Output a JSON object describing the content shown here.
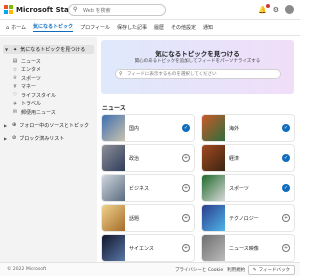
{
  "header": {
    "brand": "Microsoft Start",
    "logo_colors": [
      "#f25022",
      "#7fba00",
      "#00a4ef",
      "#ffb900"
    ],
    "search_placeholder": "Web を検索",
    "icons": [
      "bell-icon",
      "gear-icon",
      "avatar"
    ]
  },
  "nav": {
    "items": [
      {
        "label": "ホーム",
        "icon": "home-icon",
        "active": false
      },
      {
        "label": "気になるトピック",
        "active": true
      },
      {
        "label": "プロフィール",
        "active": false
      },
      {
        "label": "保存した記事",
        "active": false
      },
      {
        "label": "履歴",
        "active": false
      },
      {
        "label": "その他設定",
        "active": false
      },
      {
        "label": "通知",
        "active": false
      }
    ]
  },
  "sidebar": {
    "discover": {
      "label": "気になるトピックを見つける",
      "icon": "sparkle-icon"
    },
    "items": [
      {
        "label": "ニュース",
        "icon": "news-icon"
      },
      {
        "label": "エンタメ",
        "icon": "star-icon"
      },
      {
        "label": "スポーツ",
        "icon": "trophy-icon"
      },
      {
        "label": "マネー",
        "icon": "money-icon"
      },
      {
        "label": "ライフスタイル",
        "icon": "heart-icon"
      },
      {
        "label": "トラベル",
        "icon": "plane-icon"
      },
      {
        "label": "郵便用ニュース",
        "icon": "mail-icon"
      }
    ],
    "following": {
      "label": "フォロー中のソースとトピック",
      "icon": "follow-icon"
    },
    "blocked": {
      "label": "ブロック済みリスト",
      "icon": "block-icon"
    }
  },
  "banner": {
    "title": "気になるトピックを見つける",
    "subtitle": "関心のあるトピックを追加してフィードをパーソナライズする",
    "search_placeholder": "フィードに表示するものを選択してください"
  },
  "section": {
    "title": "ニュース"
  },
  "topics": [
    {
      "label": "国内",
      "followed": true,
      "colors": [
        "#3f6fb1",
        "#c9c3ad"
      ]
    },
    {
      "label": "海外",
      "followed": true,
      "colors": [
        "#c85a2a",
        "#2e6d3b"
      ]
    },
    {
      "label": "政治",
      "followed": false,
      "colors": [
        "#8c8f97",
        "#2f3d5a"
      ]
    },
    {
      "label": "経済",
      "followed": true,
      "colors": [
        "#a2491f",
        "#3b2514"
      ]
    },
    {
      "label": "ビジネス",
      "followed": false,
      "colors": [
        "#cfd6de",
        "#5b6c80"
      ]
    },
    {
      "label": "スポーツ",
      "followed": true,
      "colors": [
        "#1f6a2c",
        "#d9d9d9"
      ]
    },
    {
      "label": "話題",
      "followed": false,
      "colors": [
        "#efd28b",
        "#a56c2a"
      ]
    },
    {
      "label": "テクノロジー",
      "followed": false,
      "colors": [
        "#2a3c8c",
        "#4fb5e8"
      ]
    },
    {
      "label": "サイエンス",
      "followed": false,
      "colors": [
        "#10162b",
        "#5a78a8"
      ]
    },
    {
      "label": "ニュース映像",
      "followed": false,
      "colors": [
        "#6e6e6e",
        "#bcbcbc"
      ]
    }
  ],
  "footer": {
    "copyright": "© 2022 Microsoft",
    "links": [
      "プライバシーと Cookie",
      "利用規約",
      "広告"
    ],
    "feedback": "フィードバック"
  }
}
